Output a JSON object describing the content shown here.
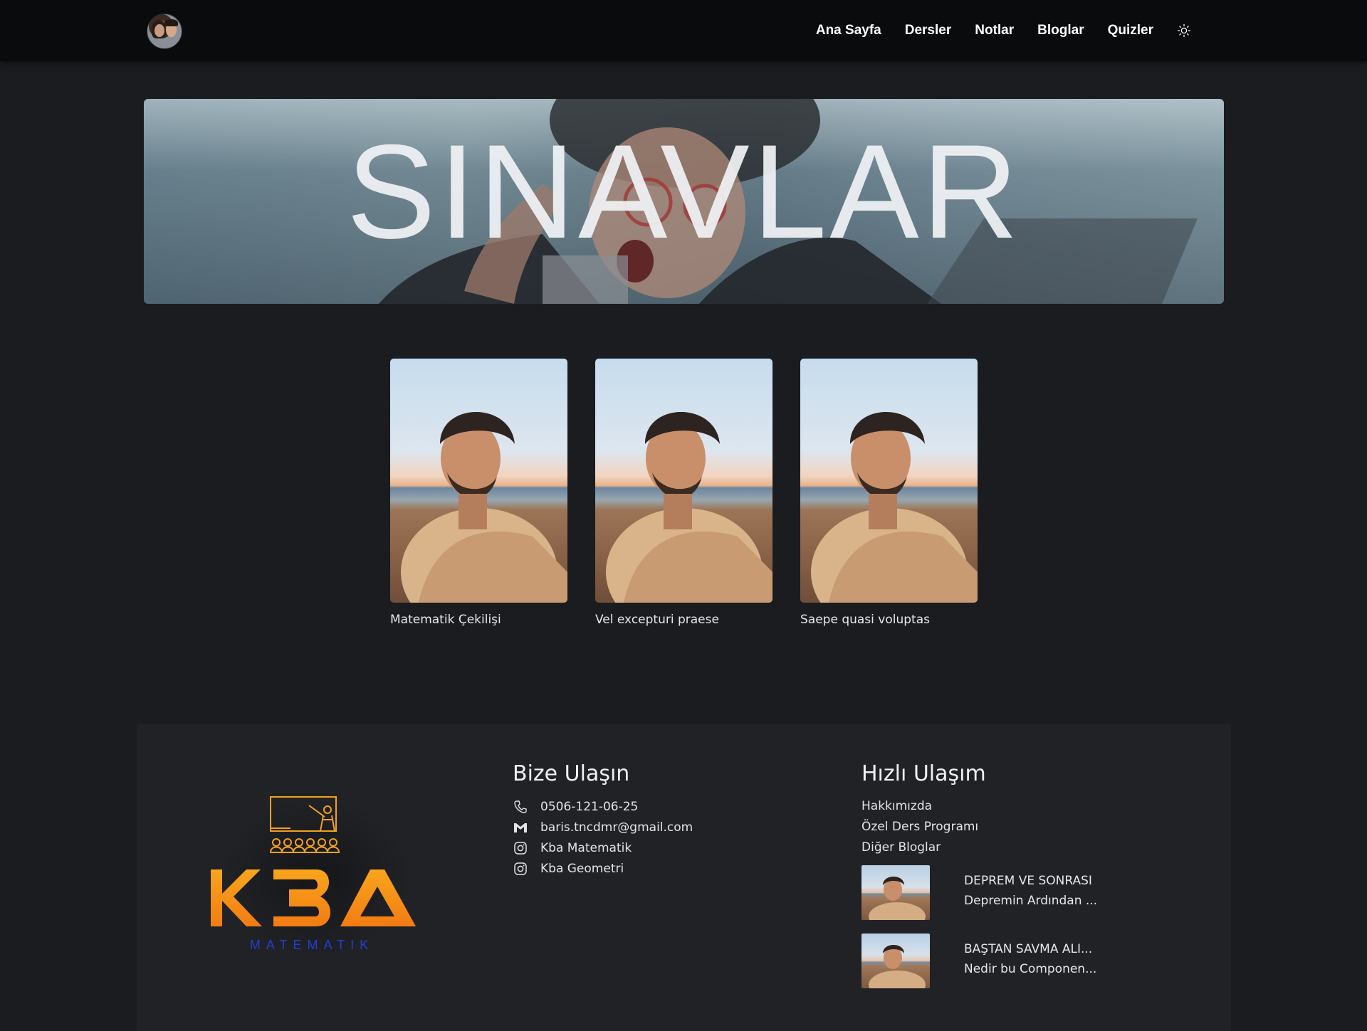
{
  "nav": {
    "avatar_icon": "couple-avatar",
    "links": [
      "Ana Sayfa",
      "Dersler",
      "Notlar",
      "Bloglar",
      "Quizler"
    ],
    "theme_icon": "sun-icon"
  },
  "hero": {
    "title": "SINAVLAR"
  },
  "cards": [
    {
      "title": "Matematik Çekilişi"
    },
    {
      "title": "Vel excepturi praese"
    },
    {
      "title": "Saepe quasi voluptas"
    }
  ],
  "footer": {
    "logo": {
      "main_text": "KBA",
      "sub_text": "MATEMATIK",
      "colors": {
        "orange": "#f7a21b",
        "blue": "#1f3fd4"
      }
    },
    "contact": {
      "heading": "Bize Ulaşın",
      "items": [
        {
          "icon": "phone-icon",
          "text": "0506-121-06-25"
        },
        {
          "icon": "mail-icon",
          "text": "baris.tncdmr@gmail.com"
        },
        {
          "icon": "instagram-icon",
          "text": "Kba Matematik"
        },
        {
          "icon": "instagram-icon",
          "text": "Kba Geometri"
        }
      ]
    },
    "quick": {
      "heading": "Hızlı Ulaşım",
      "links": [
        "Hakkımızda",
        "Özel Ders Programı",
        "Diğer Bloglar"
      ],
      "blogs": [
        {
          "title": "DEPREM VE SONRASI",
          "desc": "Depremin Ardından ..."
        },
        {
          "title": "BAŞTAN SAVMA ALI...",
          "desc": "Nedir bu Componen..."
        }
      ]
    }
  },
  "colors": {
    "page_bg": "#1b1c20",
    "navbar_bg": "#090b0d",
    "footer_bg": "#212226"
  }
}
